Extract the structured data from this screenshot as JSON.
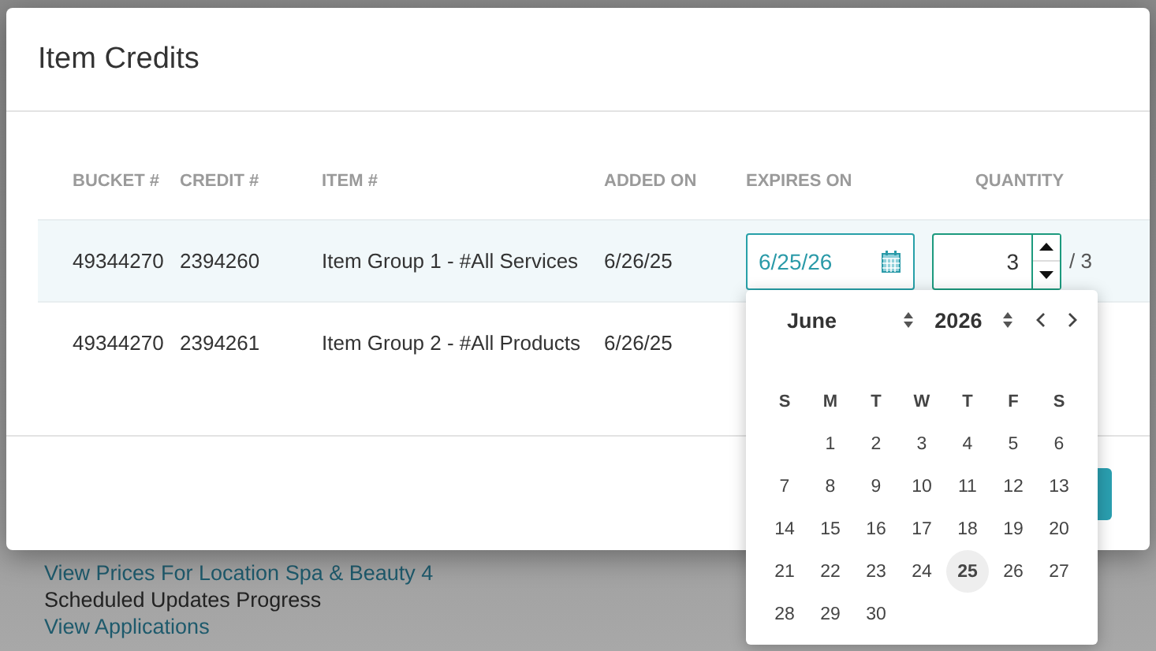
{
  "background": {
    "items": [
      {
        "kind": "link",
        "text": "View Prices For Location Spa & Beauty 4"
      },
      {
        "kind": "text",
        "text": "Scheduled Updates Progress"
      },
      {
        "kind": "link",
        "text": "View Applications"
      }
    ]
  },
  "modal": {
    "title": "Item Credits",
    "columns": [
      "BUCKET #",
      "CREDIT #",
      "ITEM #",
      "ADDED ON",
      "EXPIRES ON",
      "QUANTITY"
    ],
    "rows": [
      {
        "bucket": "49344270",
        "credit": "2394260",
        "item": "Item Group 1 - #All Services",
        "added_on": "6/26/25",
        "editing": true,
        "expires_on": "6/25/26",
        "quantity": "3",
        "quantity_total": "/ 3"
      },
      {
        "bucket": "49344270",
        "credit": "2394261",
        "item": "Item Group 2 - #All Products",
        "added_on": "6/26/25",
        "editing": false
      }
    ]
  },
  "datepicker": {
    "month": "June",
    "year": "2026",
    "weekdays": [
      "S",
      "M",
      "T",
      "W",
      "T",
      "F",
      "S"
    ],
    "weeks": [
      {
        "days": [
          {
            "day": "1",
            "selected": false
          },
          {
            "day": "2",
            "selected": false
          },
          {
            "day": "3",
            "selected": false
          },
          {
            "day": "4",
            "selected": false
          },
          {
            "day": "5",
            "selected": false
          },
          {
            "day": "6",
            "selected": false
          }
        ]
      },
      {
        "days": [
          {
            "day": "7",
            "selected": false
          },
          {
            "day": "8",
            "selected": false
          },
          {
            "day": "9",
            "selected": false
          },
          {
            "day": "10",
            "selected": false
          },
          {
            "day": "11",
            "selected": false
          },
          {
            "day": "12",
            "selected": false
          },
          {
            "day": "13",
            "selected": false
          }
        ]
      },
      {
        "days": [
          {
            "day": "14",
            "selected": false
          },
          {
            "day": "15",
            "selected": false
          },
          {
            "day": "16",
            "selected": false
          },
          {
            "day": "17",
            "selected": false
          },
          {
            "day": "18",
            "selected": false
          },
          {
            "day": "19",
            "selected": false
          },
          {
            "day": "20",
            "selected": false
          }
        ]
      },
      {
        "days": [
          {
            "day": "21",
            "selected": false
          },
          {
            "day": "22",
            "selected": false
          },
          {
            "day": "23",
            "selected": false
          },
          {
            "day": "24",
            "selected": false
          },
          {
            "day": "25",
            "selected": true
          },
          {
            "day": "26",
            "selected": false
          },
          {
            "day": "27",
            "selected": false
          }
        ]
      },
      {
        "days": [
          {
            "day": "28",
            "selected": false
          },
          {
            "day": "29",
            "selected": false
          },
          {
            "day": "30",
            "selected": false
          }
        ]
      }
    ]
  }
}
